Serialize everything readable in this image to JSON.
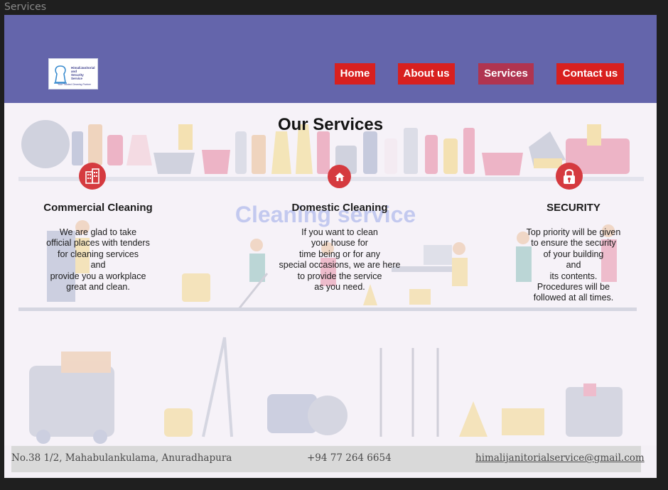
{
  "window": {
    "title": "Services"
  },
  "header": {
    "logo": {
      "name_lines": [
        "HimaliJanitorial",
        "and",
        "Security",
        "Service"
      ],
      "tagline": "Your Trusted Cleaning Partner"
    },
    "nav": [
      {
        "label": "Home",
        "active": false
      },
      {
        "label": "About us",
        "active": false
      },
      {
        "label": "Services",
        "active": true
      },
      {
        "label": "Contact us",
        "active": false
      }
    ]
  },
  "main": {
    "background_caption": "Cleaning service",
    "title": "Our Services",
    "services": [
      {
        "icon": "office-building-icon",
        "title": "Commercial Cleaning",
        "text": "We are glad to take\nofficial places with tenders\nfor cleaning services\nand\nprovide you a workplace\ngreat and clean."
      },
      {
        "icon": "house-icon",
        "title": "Domestic Cleaning",
        "text": "If you want to clean\nyour house for\ntime being or for any\nspecial occasions, we are here\nto provide the service\nas you need."
      },
      {
        "icon": "padlock-icon",
        "title": "SECURITY",
        "text": "Top priority will be given\nto ensure the security\nof your building\nand\nits contents.\nProcedures will be\nfollowed at all times."
      }
    ]
  },
  "footer": {
    "address": "No.38 1/2, Mahabulankulama, Anuradhapura",
    "phone": "+94 77 264 6654",
    "email": "himalijanitorialservice@gmail.com"
  },
  "colors": {
    "header_bg": "#6465ab",
    "nav_button": "#d8201f",
    "nav_active": "#b03450",
    "icon_circle": "#d53a3f",
    "footer_bg": "#d9d9d9"
  }
}
